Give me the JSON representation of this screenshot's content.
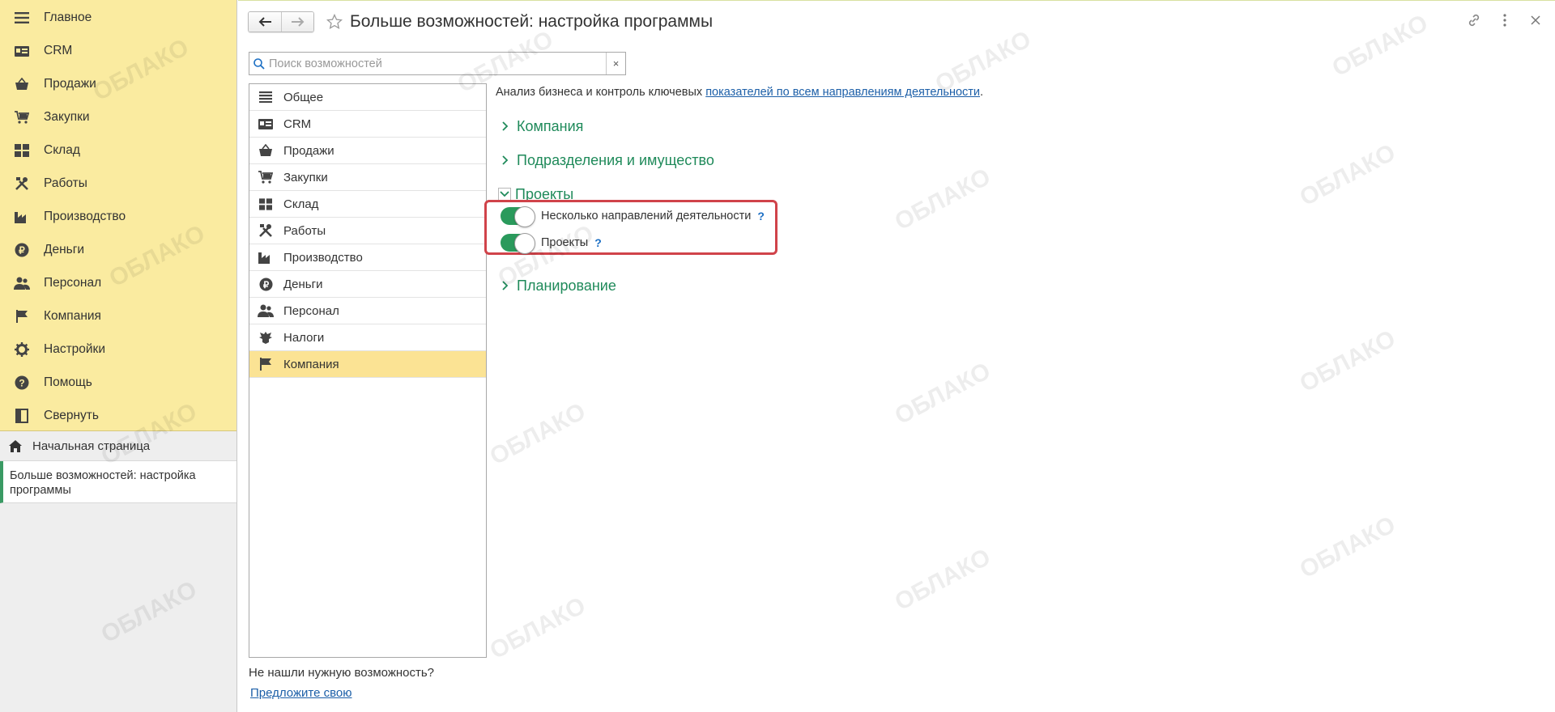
{
  "nav": {
    "items": [
      {
        "label": "Главное",
        "icon": "menu-icon"
      },
      {
        "label": "CRM",
        "icon": "crm-icon"
      },
      {
        "label": "Продажи",
        "icon": "basket-icon"
      },
      {
        "label": "Закупки",
        "icon": "cart-icon"
      },
      {
        "label": "Склад",
        "icon": "warehouse-icon"
      },
      {
        "label": "Работы",
        "icon": "tools-icon"
      },
      {
        "label": "Производство",
        "icon": "factory-icon"
      },
      {
        "label": "Деньги",
        "icon": "ruble-icon"
      },
      {
        "label": "Персонал",
        "icon": "people-icon"
      },
      {
        "label": "Компания",
        "icon": "flag-icon"
      },
      {
        "label": "Настройки",
        "icon": "gear-icon"
      },
      {
        "label": "Помощь",
        "icon": "help-icon"
      },
      {
        "label": "Свернуть",
        "icon": "collapse-icon"
      }
    ],
    "home_label": "Начальная страница",
    "open_doc_label": "Больше возможностей: настройка программы"
  },
  "header": {
    "title": "Больше возможностей: настройка программы"
  },
  "search": {
    "placeholder": "Поиск возможностей",
    "value": "",
    "clear_label": "×"
  },
  "sections": [
    {
      "label": "Общее",
      "icon": "menu-icon"
    },
    {
      "label": "CRM",
      "icon": "crm-icon"
    },
    {
      "label": "Продажи",
      "icon": "basket-icon"
    },
    {
      "label": "Закупки",
      "icon": "cart-icon"
    },
    {
      "label": "Склад",
      "icon": "warehouse-icon"
    },
    {
      "label": "Работы",
      "icon": "tools-icon"
    },
    {
      "label": "Производство",
      "icon": "factory-icon"
    },
    {
      "label": "Деньги",
      "icon": "ruble-icon"
    },
    {
      "label": "Персонал",
      "icon": "people-icon"
    },
    {
      "label": "Налоги",
      "icon": "eagle-icon"
    },
    {
      "label": "Компания",
      "icon": "flag-icon",
      "active": true
    }
  ],
  "footer": {
    "not_found": "Не нашли нужную возможность?",
    "suggest_link": "Предложите свою"
  },
  "content": {
    "description_prefix": "Анализ бизнеса и контроль ключевых ",
    "description_link": "показателей по всем направлениям деятельности",
    "description_suffix": ".",
    "groups": {
      "company": "Компания",
      "divisions": "Подразделения и имущество",
      "projects": "Проекты",
      "planning": "Планирование"
    },
    "toggles": [
      {
        "label": "Несколько направлений деятельности",
        "on": true
      },
      {
        "label": "Проекты",
        "on": true
      }
    ],
    "help_mark": "?"
  },
  "watermark": {
    "text": "ОБЛАКО"
  },
  "colors": {
    "nav_bg": "#faeba0",
    "accent_green": "#1f8a5a",
    "toggle_on": "#2a9a5c",
    "highlight_red": "#d0434a",
    "active_section": "#fbe394",
    "link_blue": "#1c5fa8"
  }
}
